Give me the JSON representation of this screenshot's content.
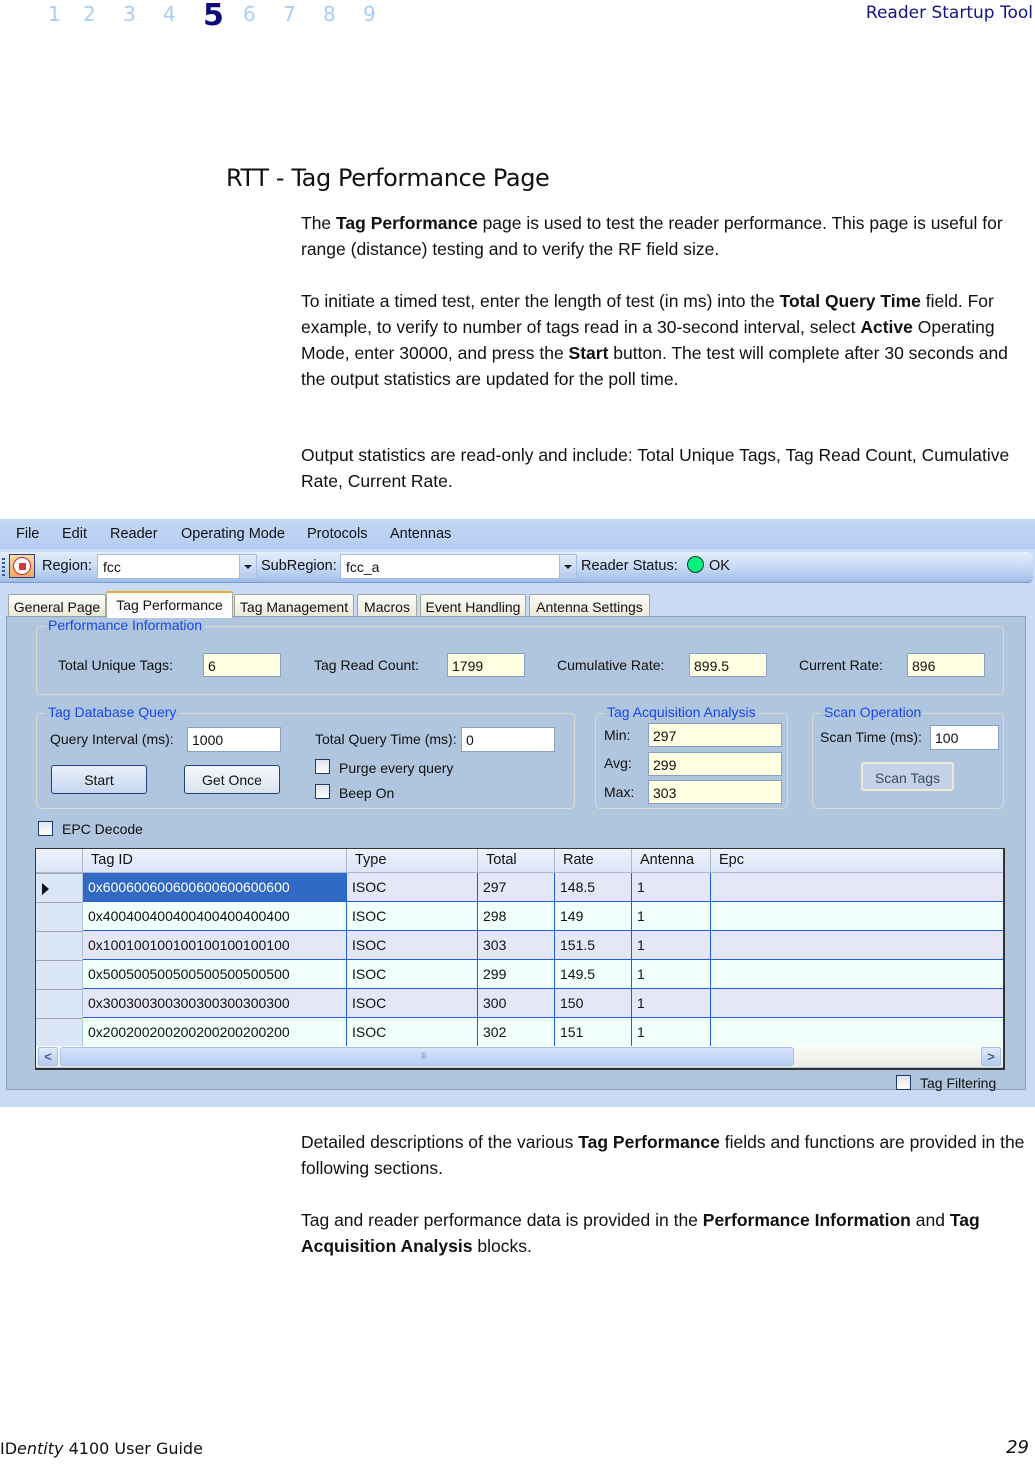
{
  "header": {
    "chapters": [
      "1",
      "2",
      "3",
      "4",
      "5",
      "6",
      "7",
      "8",
      "9"
    ],
    "active_chapter": "5",
    "running_head": "Reader Startup Tool"
  },
  "section_title": "RTT - Tag Performance Page",
  "paragraphs": {
    "p1": {
      "a": "The ",
      "b1": "Tag Performance",
      "c": " page is used to test the reader performance. This page is useful for range (distance) testing and to verify the RF field size."
    },
    "p2": {
      "a": "To initiate a timed test, enter the length of test (in ms) into the ",
      "b1": "Total Query Time",
      "c": " field. For example, to verify to number of tags read in a 30-second interval, select ",
      "b2": "Active",
      "d": " Operating Mode, enter 30000, and press the ",
      "b3": "Start",
      "e": " button. The test will complete after 30 seconds and the output statistics are updated for the poll time."
    },
    "p3": {
      "a": "Output statistics are read-only and include: Total Unique Tags, Tag Read Count, Cumulative Rate, Current Rate."
    },
    "p4": {
      "a": "Detailed descriptions of the various ",
      "b1": "Tag Performance",
      "c": " fields and functions are provided in the following sections."
    },
    "p5": {
      "a": "Tag and reader performance data is provided in the ",
      "b1": "Performance Information",
      "c": " and ",
      "b2": "Tag Acquisition Analysis",
      "d": " blocks."
    }
  },
  "app": {
    "menu": [
      "File",
      "Edit",
      "Reader",
      "Operating Mode",
      "Protocols",
      "Antennas"
    ],
    "toolbar": {
      "stop_icon": "stop-icon",
      "region_label": "Region:",
      "region_value": "fcc",
      "subregion_label": "SubRegion:",
      "subregion_value": "fcc_a",
      "status_label": "Reader Status:",
      "status_value": "OK",
      "status_color": "#00f27a"
    },
    "tabs": [
      "General Page",
      "Tag Performance",
      "Tag Management",
      "Macros",
      "Event Handling",
      "Antenna Settings"
    ],
    "active_tab": "Tag Performance",
    "performance_info": {
      "title": "Performance Information",
      "total_unique_tags_label": "Total Unique Tags:",
      "total_unique_tags": "6",
      "tag_read_count_label": "Tag Read Count:",
      "tag_read_count": "1799",
      "cumulative_rate_label": "Cumulative Rate:",
      "cumulative_rate": "899.5",
      "current_rate_label": "Current Rate:",
      "current_rate": "896"
    },
    "tag_db_query": {
      "title": "Tag Database Query",
      "query_interval_label": "Query Interval (ms):",
      "query_interval": "1000",
      "total_query_time_label": "Total Query Time (ms):",
      "total_query_time": "0",
      "start_label": "Start",
      "get_once_label": "Get Once",
      "purge_label": "Purge every query",
      "purge_checked": false,
      "beep_label": "Beep On",
      "beep_checked": false
    },
    "acquisition": {
      "title": "Tag Acquisition Analysis",
      "min_label": "Min:",
      "min": "297",
      "avg_label": "Avg:",
      "avg": "299",
      "max_label": "Max:",
      "max": "303"
    },
    "scan": {
      "title": "Scan Operation",
      "scan_time_label": "Scan Time (ms):",
      "scan_time": "100",
      "scan_tags_label": "Scan Tags"
    },
    "epc_decode_label": "EPC Decode",
    "epc_decode_checked": false,
    "grid": {
      "columns": [
        "Tag ID",
        "Type",
        "Total",
        "Rate",
        "Antenna",
        "Epc"
      ],
      "rows": [
        [
          "0x600600600600600600600600",
          "ISOC",
          "297",
          "148.5",
          "1",
          ""
        ],
        [
          "0x400400400400400400400400",
          "ISOC",
          "298",
          "149",
          "1",
          ""
        ],
        [
          "0x100100100100100100100100",
          "ISOC",
          "303",
          "151.5",
          "1",
          ""
        ],
        [
          "0x500500500500500500500500",
          "ISOC",
          "299",
          "149.5",
          "1",
          ""
        ],
        [
          "0x300300300300300300300300",
          "ISOC",
          "300",
          "150",
          "1",
          ""
        ],
        [
          "0x200200200200200200200200",
          "ISOC",
          "302",
          "151",
          "1",
          ""
        ]
      ],
      "selected_row": 0,
      "scroll_left": "<",
      "scroll_right": ">",
      "thumb_grip": "III"
    },
    "tag_filtering_label": "Tag Filtering",
    "tag_filtering_checked": false
  },
  "footer": {
    "product_prefix": "ID",
    "product_italic": "entity",
    "product_suffix": " 4100 User Guide",
    "page_number": "29"
  }
}
